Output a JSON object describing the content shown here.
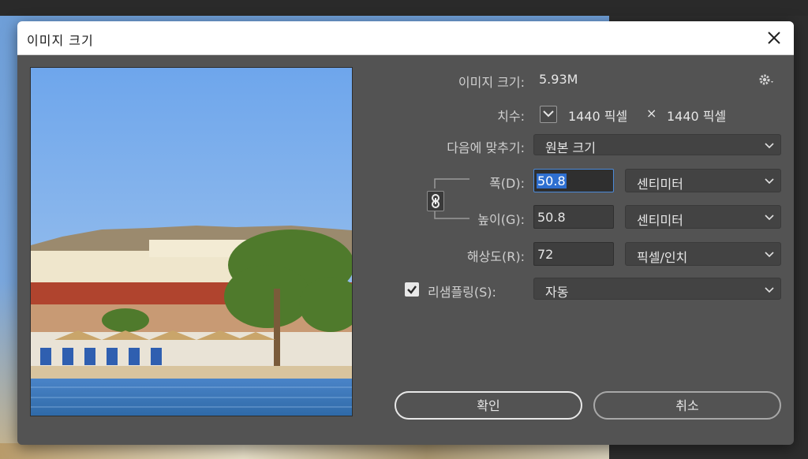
{
  "dialog": {
    "title": "이미지 크기"
  },
  "image_size": {
    "label": "이미지 크기:",
    "value": "5.93M"
  },
  "dimensions": {
    "label": "치수:",
    "width_value": "1440 픽셀",
    "separator": "×",
    "height_value": "1440 픽셀"
  },
  "fit_to": {
    "label": "다음에 맞추기:",
    "selected": "원본 크기"
  },
  "width": {
    "label": "폭(D):",
    "value": "50.8",
    "unit": "센티미터"
  },
  "height": {
    "label": "높이(G):",
    "value": "50.8",
    "unit": "센티미터"
  },
  "resolution": {
    "label": "해상도(R):",
    "value": "72",
    "unit": "픽셀/인치"
  },
  "resample": {
    "label": "리샘플링(S):",
    "checked": true,
    "selected": "자동"
  },
  "buttons": {
    "ok": "확인",
    "cancel": "취소"
  },
  "colors": {
    "dialog_bg": "#535353",
    "focus_accent": "#2e6fd0",
    "titlebar_bg": "#ffffff"
  }
}
